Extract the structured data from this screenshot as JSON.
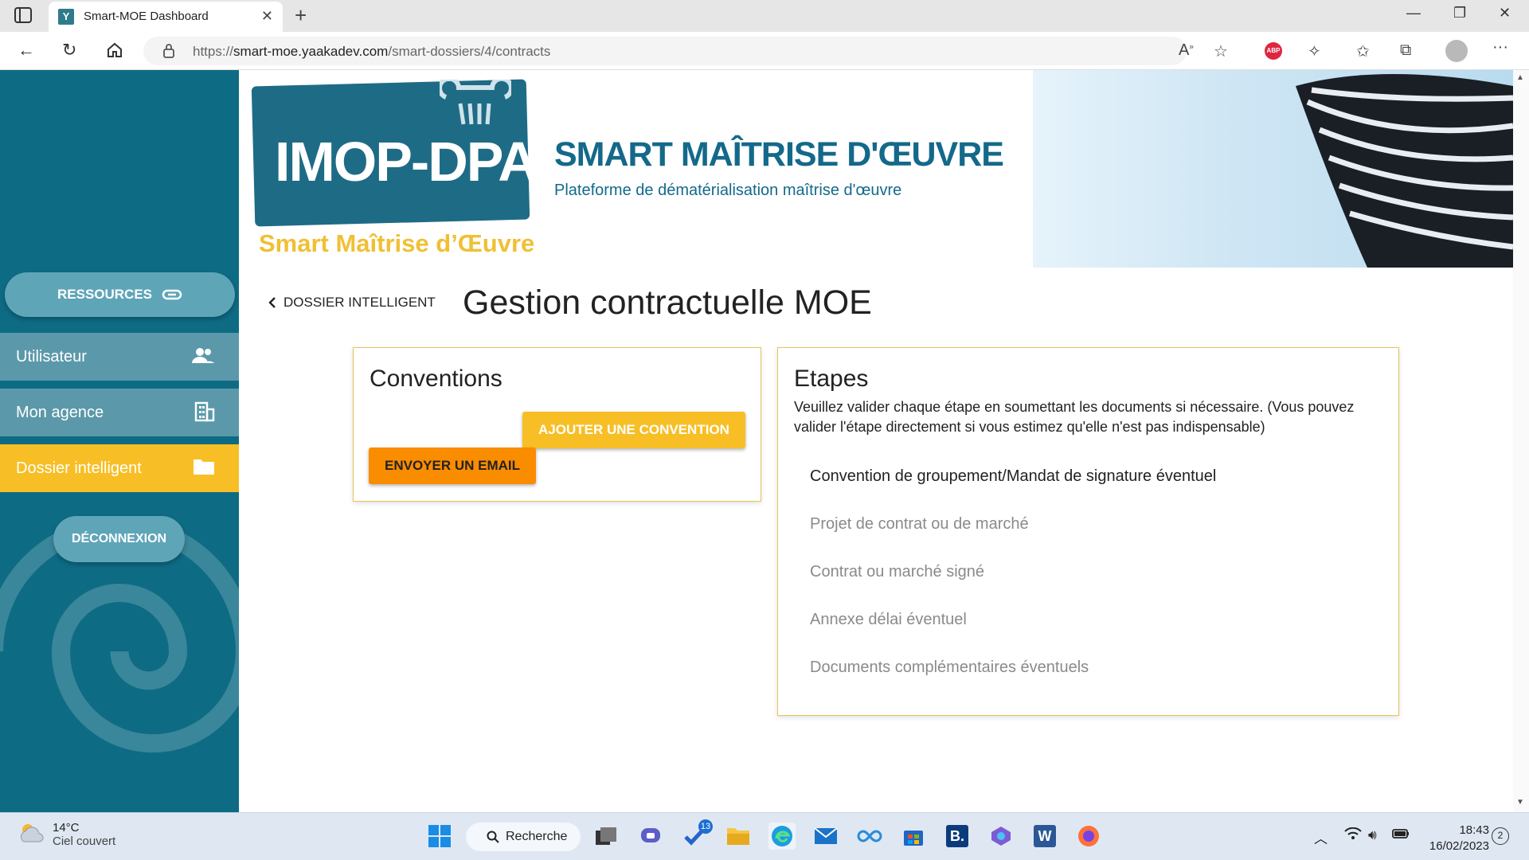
{
  "browser": {
    "tab_title": "Smart-MOE Dashboard",
    "tab_favicon": "Y",
    "url_prefix": "https://",
    "url_host": "smart-moe.yaakadev.com",
    "url_path": "/smart-dossiers/4/contracts"
  },
  "banner": {
    "logo_text": "IMOP-DPA",
    "logo_subtitle": "Smart Maîtrise d’Œuvre",
    "title": "SMART MAÎTRISE D'ŒUVRE",
    "subtitle": "Plateforme de dématérialisation maîtrise d'œuvre"
  },
  "sidebar": {
    "resources_label": "RESSOURCES",
    "items": [
      {
        "label": "Utilisateur",
        "icon": "users-icon"
      },
      {
        "label": "Mon agence",
        "icon": "building-icon"
      },
      {
        "label": "Dossier intelligent",
        "icon": "folder-icon"
      }
    ],
    "logout_label": "DÉCONNEXION"
  },
  "page": {
    "back_label": "DOSSIER INTELLIGENT",
    "title": "Gestion contractuelle MOE"
  },
  "conventions": {
    "title": "Conventions",
    "add_label": "AJOUTER UNE CONVENTION",
    "email_label": "ENVOYER UN EMAIL"
  },
  "steps": {
    "title": "Etapes",
    "description": "Veuillez valider chaque étape en soumettant les documents si nécessaire. (Vous pouvez valider l'étape directement si vous estimez qu'elle n'est pas indispensable)",
    "items": [
      "Convention de groupement/Mandat de signature éventuel",
      "Projet de contrat ou de marché",
      "Contrat ou marché signé",
      "Annexe délai éventuel",
      "Documents complémentaires éventuels"
    ]
  },
  "taskbar": {
    "temperature": "14°C",
    "weather": "Ciel couvert",
    "search_label": "Recherche",
    "todo_badge": "13",
    "time": "18:43",
    "date": "16/02/2023",
    "notifications": "2"
  },
  "colors": {
    "sidebar": "#0e6b84",
    "accent_yellow": "#f7bf25",
    "accent_orange": "#fa8c00",
    "brand_blue": "#14698a"
  }
}
